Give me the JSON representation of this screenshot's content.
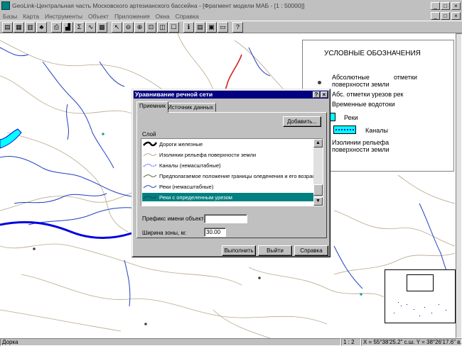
{
  "window": {
    "title": "GeoLink-Центральная часть Московского артезианского бассейна - [Фрагмент модели МАБ - [1 : 50000]]",
    "controls": [
      "_",
      "□",
      "×"
    ]
  },
  "menu": {
    "items": [
      "Базы",
      "Карта",
      "Инструменты",
      "Объект",
      "Приложения",
      "Окна",
      "Справка"
    ]
  },
  "toolbar": {
    "tools": [
      {
        "icon": "open-database-icon",
        "glyph": "▤"
      },
      {
        "icon": "database-icon",
        "glyph": "▦"
      },
      {
        "icon": "layers-icon",
        "glyph": "▥"
      },
      {
        "icon": "tree-icon",
        "glyph": "♣"
      },
      {
        "icon": "print-icon",
        "glyph": "⎙"
      },
      {
        "icon": "chart-icon",
        "glyph": "▟"
      },
      {
        "icon": "stats-icon",
        "glyph": "Σ"
      },
      {
        "icon": "graph-icon",
        "glyph": "∿"
      },
      {
        "icon": "grid-icon",
        "glyph": "▩"
      },
      {
        "icon": "pointer-icon",
        "glyph": "↖"
      },
      {
        "icon": "zoom-out-icon",
        "glyph": "⊖"
      },
      {
        "icon": "zoom-in-icon",
        "glyph": "⊕"
      },
      {
        "icon": "zoom-window-icon",
        "glyph": "⊡"
      },
      {
        "icon": "zoom-extent-icon",
        "glyph": "◫"
      },
      {
        "icon": "pan-icon",
        "glyph": "☐"
      },
      {
        "icon": "info-icon",
        "glyph": "ℹ"
      },
      {
        "icon": "table-icon",
        "glyph": "▤"
      },
      {
        "icon": "report-icon",
        "glyph": "▣"
      },
      {
        "icon": "export-icon",
        "glyph": "▭"
      },
      {
        "icon": "help-icon",
        "glyph": "?"
      }
    ]
  },
  "legend": {
    "title": "УСЛОВНЫЕ ОБОЗНАЧЕНИЯ",
    "abs_marks_line1_a": "Абсолютные",
    "abs_marks_line1_b": "отметки",
    "abs_marks_line2": "поверхности земли",
    "water_marks": "Абс. отметки урезов рек",
    "temp_streams": "Временные водотоки",
    "rivers": "Реки",
    "canals": "Каналы",
    "contours_line1": "Изолинии рельефа",
    "contours_line2": "поверхности земли",
    "colors": {
      "river": "#00ffff",
      "canal_line": "#0000ff"
    }
  },
  "dialog": {
    "title": "Уравнивание речной сети",
    "help_btn": "?",
    "close_btn": "×",
    "tabs": [
      "Приемник",
      "Источник данных"
    ],
    "add_button": "Добавить...",
    "layer_label": "Слой",
    "layers": [
      {
        "name": "Дороги железные",
        "symbol": "rail"
      },
      {
        "name": "Изолинии рельефа поверхности земли",
        "symbol": "contour"
      },
      {
        "name": "Каналы (немасштабные)",
        "symbol": "canal"
      },
      {
        "name": "Предполагаемое положение границы оледенения и его возраст",
        "symbol": "border"
      },
      {
        "name": "Реки (немасштабные)",
        "symbol": "river"
      },
      {
        "name": "Реки с определенным урезом",
        "symbol": "river-mark",
        "selected": true
      }
    ],
    "prefix_label": "Префикс имени объектов:",
    "prefix_value": "",
    "width_label": "Ширина зоны, м:",
    "width_value": "30.00",
    "run_button": "Выполнить",
    "exit_button": "Выйти",
    "help_button": "Справка"
  },
  "status": {
    "mode": "Дорка",
    "scale": "1 : 2",
    "coords": "X = 55°38'25.2\" с.ш.  Y = 38°26'17.6\" в.д."
  }
}
